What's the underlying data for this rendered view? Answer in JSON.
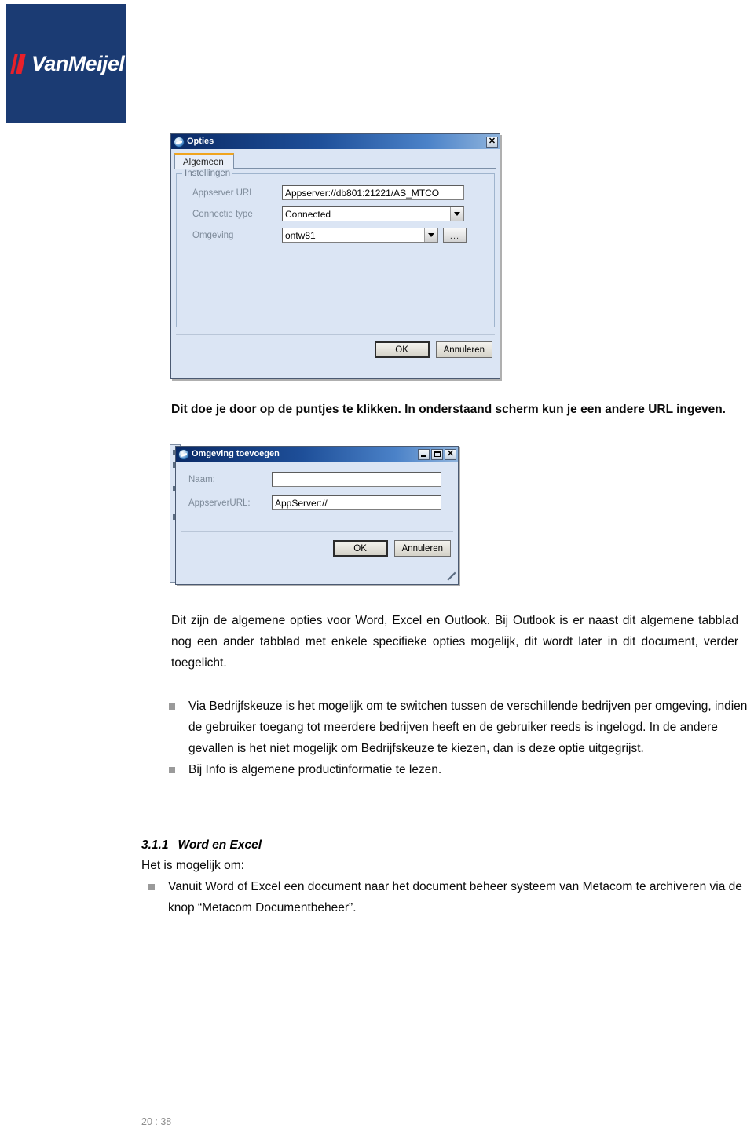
{
  "brand": {
    "logo_text": "VanMeijel",
    "logo_bg_color": "#1b3b73",
    "logo_accent_color": "#e8202a"
  },
  "options_dialog": {
    "title": "Opties",
    "close_label": "✕",
    "tabs": [
      {
        "label": "Algemeen",
        "selected": true
      }
    ],
    "group": {
      "legend": "Instellingen",
      "fields": [
        {
          "label": "Appserver URL",
          "value": "Appserver://db801:21221/AS_MTCO",
          "type": "textbox"
        },
        {
          "label": "Connectie type",
          "value": "Connected",
          "type": "combobox"
        },
        {
          "label": "Omgeving",
          "value": "ontw81",
          "type": "combobox",
          "has_browse": true
        }
      ]
    },
    "browse_button_label": "...",
    "buttons": {
      "ok": "OK",
      "cancel": "Annuleren"
    }
  },
  "caption_1": "Dit doe je door op de puntjes te klikken. In onderstaand scherm kun je een andere URL ingeven.",
  "add_environment_dialog": {
    "title": "Omgeving toevoegen",
    "minimize_label": "–",
    "maximize_label": "□",
    "close_label": "✕",
    "fields": [
      {
        "label": "Naam:",
        "value": ""
      },
      {
        "label": "AppserverURL:",
        "value": "AppServer://"
      }
    ],
    "buttons": {
      "ok": "OK",
      "cancel": "Annuleren"
    }
  },
  "body": {
    "paragraph_1": "Dit zijn de algemene opties voor Word, Excel en Outlook. Bij Outlook is er naast dit algemene tabblad nog een ander tabblad met enkele specifieke opties mogelijk, dit wordt later in dit document, verder toegelicht.",
    "bullets": [
      "Via Bedrijfskeuze is het mogelijk om te switchen tussen de verschillende bedrijven per omgeving, indien de gebruiker toegang tot meerdere bedrijven heeft en de gebruiker reeds is ingelogd. In de andere gevallen is het niet mogelijk om Bedrijfskeuze te kiezen, dan is deze optie uitgegrijst.",
      "Bij Info is algemene productinformatie te lezen."
    ]
  },
  "section": {
    "number": "3.1.1",
    "title": "Word en Excel",
    "intro": "Het is mogelijk om:",
    "bullets": [
      "Vanuit Word of Excel een document naar het document beheer systeem van Metacom te archiveren via de knop “Metacom Documentbeheer”."
    ]
  },
  "footer": {
    "page_number": "20 : 38"
  }
}
